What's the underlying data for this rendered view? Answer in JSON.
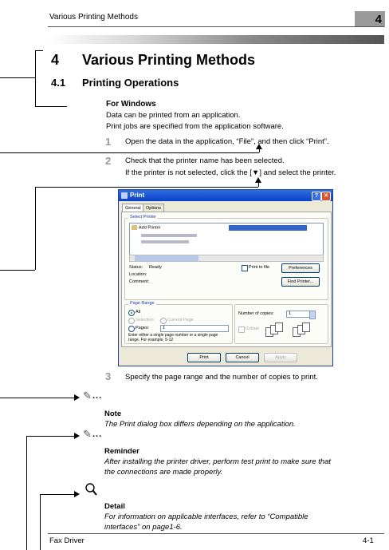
{
  "header": {
    "title": "Various Printing Methods",
    "chapter": "4"
  },
  "heading1": {
    "number": "4",
    "text": "Various Printing Methods"
  },
  "heading2": {
    "number": "4.1",
    "text": "Printing Operations"
  },
  "heading3": "For Windows",
  "intro": [
    "Data can be printed from an application.",
    "Print jobs are specified from the application software."
  ],
  "steps": [
    {
      "num": "1",
      "text": "Open the data in the application, “File”, and then click “Print”."
    },
    {
      "num": "2",
      "text": "Check that the printer name has been selected.",
      "sub": "If the printer is not selected, click the [▼] and select the printer."
    },
    {
      "num": "3",
      "text": "Specify the page range and the number of copies to print."
    }
  ],
  "dialog": {
    "title": "Print",
    "tabs": [
      "General",
      "Options"
    ],
    "select_printer": "Select Printer",
    "add_printer": "Add Printer",
    "status_label": "Status:",
    "status_value": "Ready",
    "location_label": "Location:",
    "comment_label": "Comment:",
    "print_to_file": "Print to file",
    "preferences": "Preferences",
    "find_printer": "Find Printer...",
    "page_range": "Page Range",
    "all": "All",
    "selection": "Selection",
    "current_page": "Current Page",
    "pages": "Pages:",
    "pages_value": "1",
    "range_hint": "Enter either a single page number or a single page range.  For example, 5-12",
    "copies_label": "Number of copies:",
    "copies_value": "1",
    "collate": "Collate",
    "print_btn": "Print",
    "cancel_btn": "Cancel",
    "apply_btn": "Apply"
  },
  "notes": [
    {
      "mark": "...",
      "title": "Note",
      "lines": [
        "The Print dialog box differs depending on the application."
      ]
    },
    {
      "mark": "...",
      "title": "Reminder",
      "lines": [
        "After installing the printer driver, perform test print to make sure that",
        "the connections are made properly."
      ]
    },
    {
      "title": "Detail",
      "lines": [
        "For information on applicable interfaces, refer to “Compatible",
        "interfaces” on page1-6."
      ]
    }
  ],
  "footer": {
    "left": "Fax Driver",
    "right": "4-1"
  }
}
